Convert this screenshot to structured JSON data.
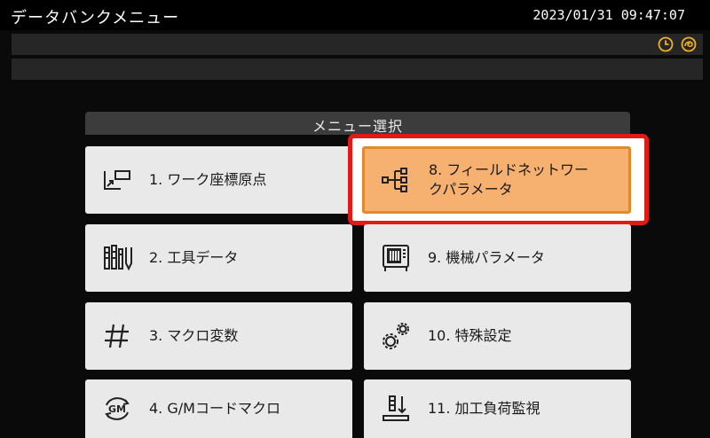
{
  "header": {
    "title": "データバンクメニュー",
    "datetime": "2023/01/31 09:47:07"
  },
  "status_icons": [
    "clock-icon",
    "spiral-icon"
  ],
  "panel": {
    "title": "メニュー選択"
  },
  "menu": {
    "item1": {
      "label": "1. ワーク座標原点",
      "icon": "work-coordinate-icon"
    },
    "item2": {
      "label": "2. 工具データ",
      "icon": "tool-data-icon"
    },
    "item3": {
      "label": "3. マクロ変数",
      "icon": "hash-icon"
    },
    "item4": {
      "label": "4. G/Mコードマクロ",
      "icon": "gm-code-icon"
    },
    "item8": {
      "label_line1": "8. フィールドネットワー",
      "label_line2": "クパラメータ",
      "icon": "network-icon",
      "selected": true
    },
    "item9": {
      "label": "9. 機械パラメータ",
      "icon": "machine-icon"
    },
    "item10": {
      "label": "10. 特殊設定",
      "icon": "gears-icon"
    },
    "item11": {
      "label": "11. 加工負荷監視",
      "icon": "load-monitor-icon"
    }
  },
  "colors": {
    "selected_fill": "#f6b171",
    "selected_border": "#e08a2c",
    "highlight_frame": "#e11b14",
    "button_fill": "#e9e9ea",
    "status_icon": "#f0b020"
  }
}
